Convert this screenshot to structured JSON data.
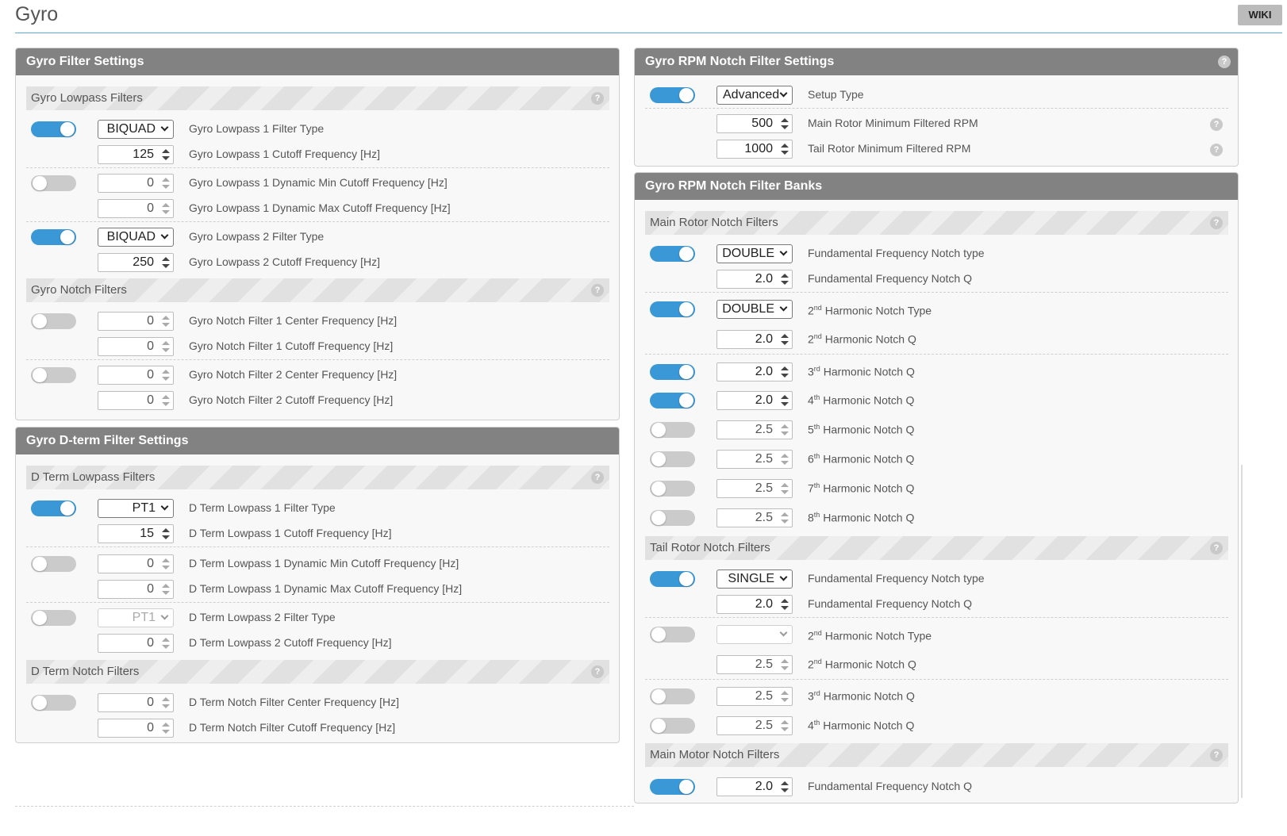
{
  "page": {
    "title": "Gyro",
    "wiki_label": "WIKI"
  },
  "gyro_filter": {
    "title": "Gyro Filter Settings",
    "lowpass": {
      "title": "Gyro Lowpass Filters",
      "rows": [
        {
          "control": "select",
          "on": true,
          "value": "BIQUAD",
          "label": "Gyro Lowpass 1 Filter Type"
        },
        {
          "control": "number",
          "value": "125",
          "label": "Gyro Lowpass 1 Cutoff Frequency [Hz]"
        },
        {
          "control": "number",
          "on": false,
          "value": "0",
          "label": "Gyro Lowpass 1 Dynamic Min Cutoff Frequency [Hz]"
        },
        {
          "control": "number",
          "value": "0",
          "label": "Gyro Lowpass 1 Dynamic Max Cutoff Frequency [Hz]"
        },
        {
          "control": "select",
          "on": true,
          "value": "BIQUAD",
          "label": "Gyro Lowpass 2 Filter Type"
        },
        {
          "control": "number",
          "value": "250",
          "label": "Gyro Lowpass 2 Cutoff Frequency [Hz]"
        }
      ]
    },
    "notch": {
      "title": "Gyro Notch Filters",
      "rows": [
        {
          "control": "number",
          "on": false,
          "value": "0",
          "label": "Gyro Notch Filter 1 Center Frequency [Hz]"
        },
        {
          "control": "number",
          "value": "0",
          "label": "Gyro Notch Filter 1 Cutoff Frequency [Hz]"
        },
        {
          "control": "number",
          "on": false,
          "value": "0",
          "label": "Gyro Notch Filter 2 Center Frequency [Hz]"
        },
        {
          "control": "number",
          "value": "0",
          "label": "Gyro Notch Filter 2 Cutoff Frequency [Hz]"
        }
      ]
    }
  },
  "dterm_filter": {
    "title": "Gyro D-term Filter Settings",
    "lowpass": {
      "title": "D Term Lowpass Filters",
      "rows": [
        {
          "control": "select",
          "on": true,
          "value": "PT1",
          "label": "D Term Lowpass 1 Filter Type"
        },
        {
          "control": "number",
          "value": "15",
          "label": "D Term Lowpass 1 Cutoff Frequency [Hz]"
        },
        {
          "control": "number",
          "on": false,
          "value": "0",
          "label": "D Term Lowpass 1 Dynamic Min Cutoff Frequency [Hz]"
        },
        {
          "control": "number",
          "value": "0",
          "label": "D Term Lowpass 1 Dynamic Max Cutoff Frequency [Hz]"
        },
        {
          "control": "select",
          "on": false,
          "value": "PT1",
          "label": "D Term Lowpass 2 Filter Type"
        },
        {
          "control": "number",
          "value": "0",
          "label": "D Term Lowpass 2 Cutoff Frequency [Hz]"
        }
      ]
    },
    "notch": {
      "title": "D Term Notch Filters",
      "rows": [
        {
          "control": "number",
          "on": false,
          "value": "0",
          "label": "D Term Notch Filter Center Frequency [Hz]"
        },
        {
          "control": "number",
          "value": "0",
          "label": "D Term Notch Filter Cutoff Frequency [Hz]"
        }
      ]
    }
  },
  "rpm_settings": {
    "title": "Gyro RPM Notch Filter Settings",
    "rows": [
      {
        "control": "select",
        "on": true,
        "value": "Advanced",
        "label": "Setup Type"
      },
      {
        "control": "number",
        "value": "500",
        "label": "Main Rotor Minimum Filtered RPM"
      },
      {
        "control": "number",
        "value": "1000",
        "label": "Tail Rotor Minimum Filtered RPM"
      }
    ]
  },
  "rpm_banks": {
    "title": "Gyro RPM Notch Filter Banks",
    "main_rotor": {
      "title": "Main Rotor Notch Filters",
      "rows": [
        {
          "control": "select",
          "on": true,
          "value": "DOUBLE",
          "label": "Fundamental Frequency Notch type"
        },
        {
          "control": "number",
          "value": "2.0",
          "label": "Fundamental Frequency Notch Q"
        },
        {
          "control": "select",
          "on": true,
          "value": "DOUBLE",
          "num": "2",
          "sup": "nd",
          "label": "Harmonic Notch Type"
        },
        {
          "control": "number",
          "value": "2.0",
          "num": "2",
          "sup": "nd",
          "label": "Harmonic Notch Q"
        },
        {
          "control": "number",
          "on": true,
          "value": "2.0",
          "num": "3",
          "sup": "rd",
          "label": "Harmonic Notch Q"
        },
        {
          "control": "number",
          "on": true,
          "value": "2.0",
          "num": "4",
          "sup": "th",
          "label": "Harmonic Notch Q"
        },
        {
          "control": "number",
          "on": false,
          "value": "2.5",
          "num": "5",
          "sup": "th",
          "label": "Harmonic Notch Q"
        },
        {
          "control": "number",
          "on": false,
          "value": "2.5",
          "num": "6",
          "sup": "th",
          "label": "Harmonic Notch Q"
        },
        {
          "control": "number",
          "on": false,
          "value": "2.5",
          "num": "7",
          "sup": "th",
          "label": "Harmonic Notch Q"
        },
        {
          "control": "number",
          "on": false,
          "value": "2.5",
          "num": "8",
          "sup": "th",
          "label": "Harmonic Notch Q"
        }
      ]
    },
    "tail_rotor": {
      "title": "Tail Rotor Notch Filters",
      "rows": [
        {
          "control": "select",
          "on": true,
          "value": "SINGLE",
          "label": "Fundamental Frequency Notch type"
        },
        {
          "control": "number",
          "value": "2.0",
          "label": "Fundamental Frequency Notch Q"
        },
        {
          "control": "select",
          "on": false,
          "value": "",
          "num": "2",
          "sup": "nd",
          "label": "Harmonic Notch Type"
        },
        {
          "control": "number",
          "value": "2.5",
          "num": "2",
          "sup": "nd",
          "label": "Harmonic Notch Q"
        },
        {
          "control": "number",
          "on": false,
          "value": "2.5",
          "num": "3",
          "sup": "rd",
          "label": "Harmonic Notch Q"
        },
        {
          "control": "number",
          "on": false,
          "value": "2.5",
          "num": "4",
          "sup": "th",
          "label": "Harmonic Notch Q"
        }
      ]
    },
    "main_motor": {
      "title": "Main Motor Notch Filters",
      "rows": [
        {
          "control": "number",
          "on": true,
          "value": "2.0",
          "label": "Fundamental Frequency Notch Q"
        }
      ]
    }
  }
}
